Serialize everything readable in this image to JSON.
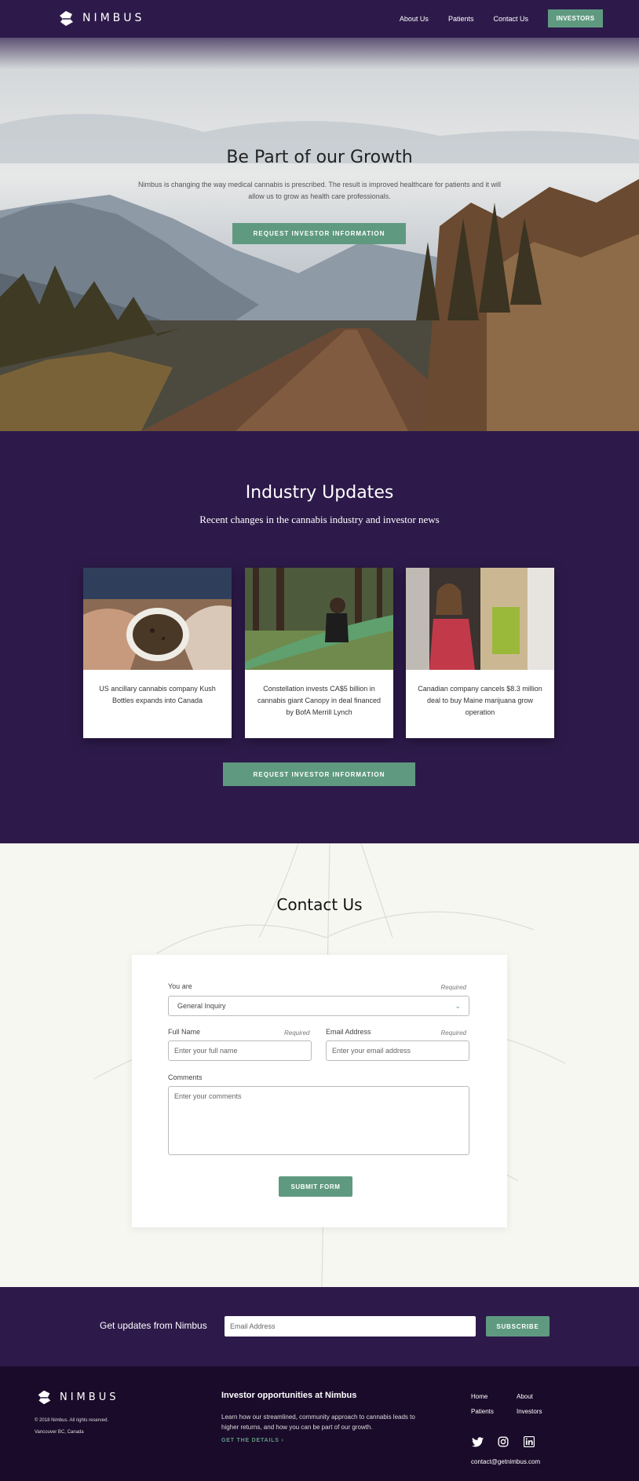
{
  "nav": {
    "logo_text": "NIMBUS",
    "links": [
      "About Us",
      "Patients",
      "Contact Us"
    ],
    "cta": "INVESTORS"
  },
  "hero": {
    "title": "Be Part of our Growth",
    "subtitle": "Nimbus is changing the way medical cannabis is prescribed.  The result is improved healthcare for patients and it will allow us to grow as health care professionals.",
    "button": "REQUEST INVESTOR INFORMATION"
  },
  "industry": {
    "title": "Industry Updates",
    "subtitle": "Recent changes in the cannabis industry and investor news",
    "cards": [
      {
        "text": "US ancillary cannabis company Kush Bottles expands into Canada"
      },
      {
        "text": "Constellation invests CA$5 billion in cannabis giant Canopy in deal financed by BofA Merrill Lynch"
      },
      {
        "text": "Canadian company cancels $8.3 million deal to buy Maine marijuana grow operation"
      }
    ],
    "button": "REQUEST INVESTOR INFORMATION"
  },
  "contact": {
    "title": "Contact Us",
    "you_are_label": "You are",
    "you_are_value": "General Inquiry",
    "required": "Required",
    "full_name_label": "Full Name",
    "full_name_placeholder": "Enter your full name",
    "email_label": "Email Address",
    "email_placeholder": "Enter your email address",
    "comments_label": "Comments",
    "comments_placeholder": "Enter your comments",
    "submit": "SUBMIT FORM"
  },
  "newsletter": {
    "text": "Get updates from Nimbus",
    "placeholder": "Email Address",
    "button": "SUBSCRIBE"
  },
  "footer": {
    "logo_text": "NIMBUS",
    "copyright": "© 2018 Nimbus. All rights reserved.",
    "location": "Vancouver BC, Canada",
    "heading": "Investor opportunities at Nimbus",
    "description": "Learn how our streamlined, community approach to cannabis leads to higher returns, and how you can be part of our growth.",
    "cta": "GET THE DETAILS  ›",
    "links": [
      "Home",
      "About",
      "Patients",
      "Investors"
    ],
    "email": "contact@getnimbus.com"
  },
  "colors": {
    "primary": "#2d1a4a",
    "accent": "#5f9a80",
    "footer": "#1a0b2a"
  }
}
